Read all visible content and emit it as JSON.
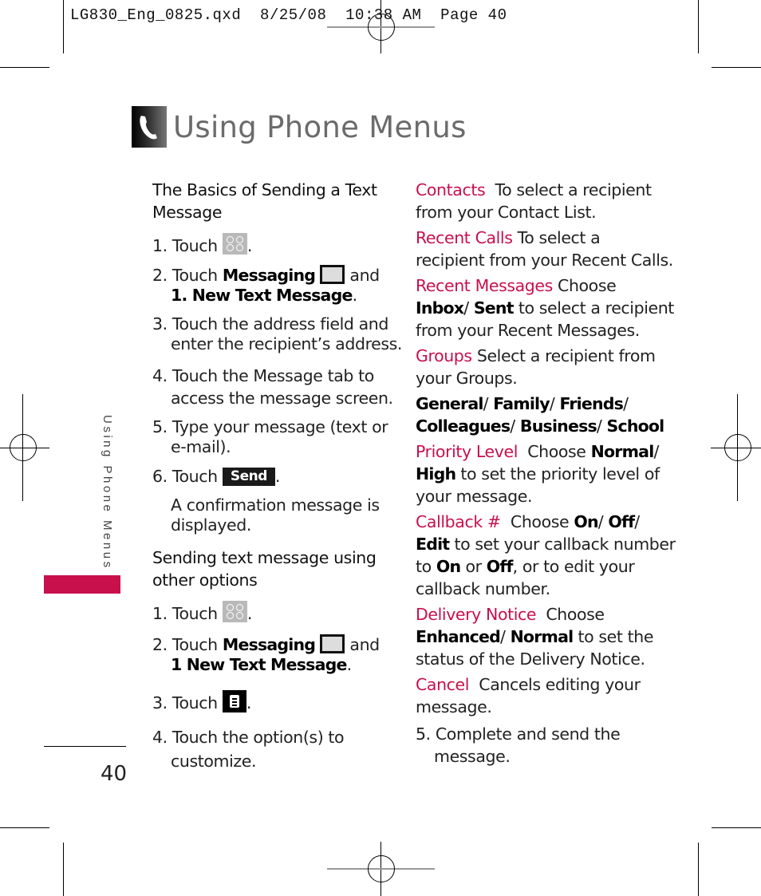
{
  "slug": "LG830_Eng_0825.qxd  8/25/08  10:38 AM  Page 40",
  "header": {
    "title": "Using Phone Menus",
    "icon": "phone-handset-icon"
  },
  "side_tab": {
    "label": "Using Phone Menus",
    "accent_color": "#c8104c"
  },
  "page_number": "40",
  "left_column": {
    "section1_heading": [
      "The Basics of Sending a Text",
      "Message"
    ],
    "steps1": [
      {
        "num": "1.",
        "text": "Touch",
        "icon": "menu-grid-icon",
        "after": "."
      },
      {
        "num": "2.",
        "text": "Touch",
        "bold": "Messaging",
        "icon": "envelope-icon",
        "after": "and",
        "line2_bold": "1. New Text Message",
        "line2_after": "."
      },
      {
        "num": "3.",
        "lines": [
          "Touch the address field and",
          "enter the recipient’s address."
        ]
      },
      {
        "num": "4.",
        "lines": [
          "Touch the Message tab to",
          "access the message screen."
        ]
      },
      {
        "num": "5.",
        "lines": [
          "Type your message (text or",
          "e-mail)."
        ]
      },
      {
        "num": "6.",
        "text": "Touch",
        "button": "Send",
        "after": "."
      }
    ],
    "confirmation": [
      "A confirmation message is",
      "displayed."
    ],
    "section2_heading": [
      "Sending text message using",
      "other options"
    ],
    "steps2": [
      {
        "num": "1.",
        "text": "Touch",
        "icon": "menu-grid-icon",
        "after": "."
      },
      {
        "num": "2.",
        "text": "Touch",
        "bold": "Messaging",
        "icon": "envelope-icon",
        "after": "and",
        "line2_bold": "1 New Text Message",
        "line2_after": "."
      },
      {
        "num": "3.",
        "text": "Touch",
        "icon": "options-menu-icon",
        "after": "."
      },
      {
        "num": "4.",
        "lines": [
          "Touch the option(s) to",
          "customize."
        ]
      }
    ]
  },
  "right_column": {
    "contacts": {
      "label": "Contacts",
      "desc1": "To select a recipient",
      "desc2": "from your Contact List."
    },
    "recent_calls": {
      "label": "Recent Calls",
      "desc1": "To select a",
      "desc2": "recipient from your Recent Calls."
    },
    "recent_messages": {
      "label": "Recent Messages",
      "desc1": "Choose",
      "opt1": "Inbox",
      "opt2": "Sent",
      "desc2": "to select a recipient",
      "desc3": "from your Recent Messages."
    },
    "groups": {
      "label": "Groups",
      "desc1": "Select a recipient from",
      "desc2": "your Groups.",
      "options": [
        "General",
        "Family",
        "Friends",
        "Colleagues",
        "Business",
        "School"
      ]
    },
    "priority": {
      "label": "Priority Level",
      "desc1": "Choose",
      "opt1": "Normal",
      "opt2": "High",
      "desc2": "to set the priority level of",
      "desc3": "your message."
    },
    "callback": {
      "label": "Callback #",
      "desc1": "Choose",
      "opt1": "On",
      "opt2": "Off",
      "opt3": "Edit",
      "desc2": "to set your callback number",
      "to": "to",
      "on": "On",
      "or": "or",
      "off": "Off",
      "desc3": ", or to edit your",
      "desc4": "callback number."
    },
    "delivery": {
      "label": "Delivery Notice",
      "desc1": "Choose",
      "opt1": "Enhanced",
      "opt2": "Normal",
      "desc2": "to set the",
      "desc3": "status of the Delivery Notice."
    },
    "cancel": {
      "label": "Cancel",
      "desc1": "Cancels editing your",
      "desc2": "message."
    },
    "step5": {
      "num": "5.",
      "lines": [
        "Complete and send the",
        "message."
      ]
    }
  }
}
